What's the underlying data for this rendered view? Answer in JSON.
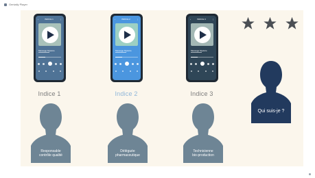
{
  "app": {
    "title": "Genially Player"
  },
  "colors": {
    "slide_bg": "#fbf6ec",
    "silhouette_light": "#6e8595",
    "silhouette_dark": "#223a5e",
    "star": "#4b4f54",
    "clue1": "#7c7c7c",
    "clue2": "#8fb6d9",
    "clue3": "#7c7c7c"
  },
  "rating": {
    "stars_shown": 3,
    "icon": "star-icon"
  },
  "clues": [
    {
      "label": "Indice 1",
      "screen_bg": "#4f7396",
      "header": "INDICE 1",
      "track_title": "Message Mystère",
      "person_text": "Responsable\ncontrôle qualité"
    },
    {
      "label": "Indice 2",
      "screen_bg": "#4b96df",
      "header": "INDICE 2",
      "track_title": "Message Mystère",
      "person_text": "Déléguée\npharmaceutique"
    },
    {
      "label": "Indice 3",
      "screen_bg": "#2f4657",
      "header": "INDICE 3",
      "track_title": "Message Mystère",
      "person_text": "Technicienne\nbio-production"
    }
  ],
  "mystery": {
    "text": "Qui suis-je ?"
  }
}
